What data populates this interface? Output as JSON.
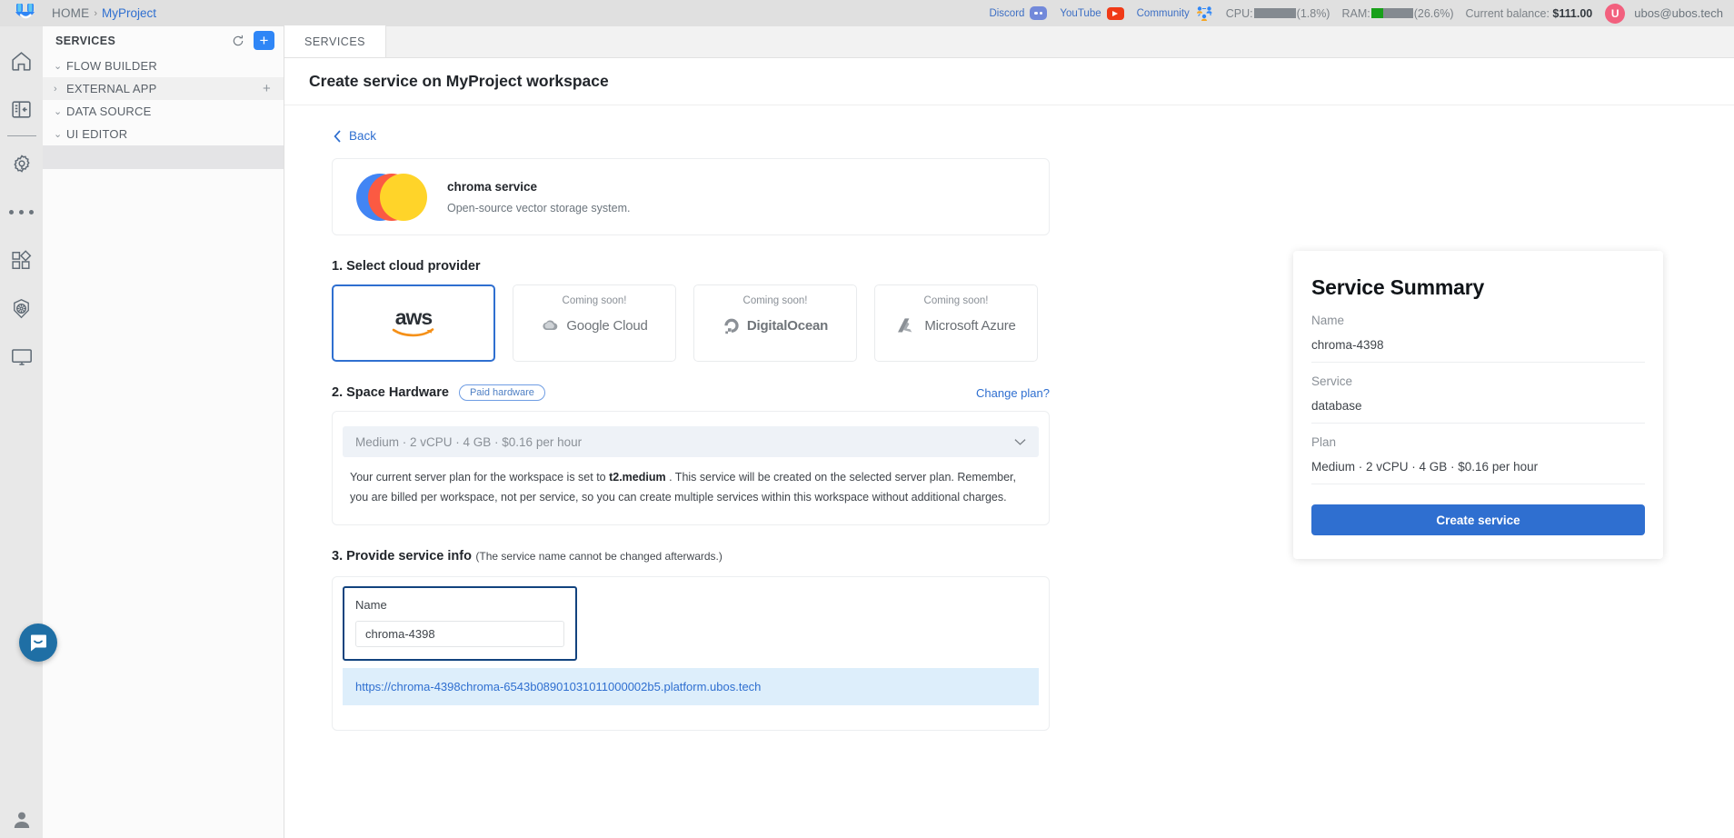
{
  "topbar": {
    "breadcrumb": {
      "home": "HOME",
      "separator": "›",
      "project": "MyProject"
    },
    "social": [
      {
        "label": "Discord",
        "icon": "discord-icon"
      },
      {
        "label": "YouTube",
        "icon": "youtube-icon"
      },
      {
        "label": "Community",
        "icon": "community-icon"
      }
    ],
    "cpu": {
      "label": "CPU:",
      "value": "(1.8%)",
      "percent": 1.8
    },
    "ram": {
      "label": "RAM:",
      "value": "(26.6%)",
      "percent": 26.6
    },
    "balance": {
      "label": "Current balance:",
      "amount": "$111.00"
    },
    "avatar_letter": "U",
    "user_email": "ubos@ubos.tech"
  },
  "rail": {
    "items": [
      {
        "name": "home-icon"
      },
      {
        "name": "panel-collapse-icon"
      },
      {
        "name": "settings-wrench-icon"
      },
      {
        "name": "more-dots-icon"
      },
      {
        "name": "apps-grid-icon"
      },
      {
        "name": "kubernetes-icon"
      },
      {
        "name": "monitor-icon"
      },
      {
        "name": "account-icon"
      }
    ]
  },
  "services_panel": {
    "title": "SERVICES",
    "refresh_label": "refresh-icon",
    "add_label": "+",
    "tree": [
      {
        "label": "FLOW BUILDER",
        "caret": "⌄",
        "expanded": true,
        "has_add": false
      },
      {
        "label": "EXTERNAL APP",
        "caret": "›",
        "expanded": false,
        "has_add": true,
        "add": "+"
      },
      {
        "label": "DATA SOURCE",
        "caret": "⌄",
        "expanded": true,
        "has_add": false
      },
      {
        "label": "UI EDITOR",
        "caret": "⌄",
        "expanded": true,
        "has_add": false
      }
    ]
  },
  "main": {
    "tab_label": "SERVICES",
    "page_title": "Create service on MyProject workspace",
    "back_label": "Back",
    "service_card": {
      "name": "chroma service",
      "description": "Open-source vector storage system."
    },
    "step1": {
      "title": "1. Select cloud provider",
      "providers": [
        {
          "name": "aws",
          "display": "aws",
          "coming_soon": "",
          "selected": true
        },
        {
          "name": "google-cloud",
          "display": "Google Cloud",
          "coming_soon": "Coming soon!",
          "selected": false
        },
        {
          "name": "digitalocean",
          "display": "DigitalOcean",
          "coming_soon": "Coming soon!",
          "selected": false
        },
        {
          "name": "microsoft-azure",
          "display": "Microsoft Azure",
          "coming_soon": "Coming soon!",
          "selected": false
        }
      ]
    },
    "step2": {
      "title": "2. Space Hardware",
      "badge": "Paid hardware",
      "change_plan": "Change plan?",
      "selected_plan": "Medium · 2 vCPU · 4 GB · $0.16 per hour",
      "note_prefix": "Your current server plan for the workspace is set to ",
      "note_bold": "t2.medium",
      "note_suffix": " . This service will be created on the selected server plan.  Remember, you are billed per workspace, not per service, so you can create multiple services within this workspace without additional charges."
    },
    "step3": {
      "title": "3. Provide service info",
      "subtitle": "(The service name cannot be changed afterwards.)",
      "name_label": "Name",
      "name_value": "chroma-4398",
      "url": "https://chroma-4398chroma-6543b08901031011000002b5.platform.ubos.tech"
    }
  },
  "summary": {
    "title": "Service Summary",
    "rows": [
      {
        "label": "Name",
        "value": "chroma-4398"
      },
      {
        "label": "Service",
        "value": "database"
      },
      {
        "label": "Plan",
        "value": "Medium · 2 vCPU · 4 GB · $0.16 per hour"
      }
    ],
    "create_button": "Create service"
  },
  "colors": {
    "accent_blue": "#2f6fd0",
    "topbar_bg": "#e0e0e0",
    "rail_bg": "#e8e8e8",
    "selected_border": "#12437e",
    "url_strip_bg": "#ddeefb",
    "ram_green": "#18a01a"
  }
}
